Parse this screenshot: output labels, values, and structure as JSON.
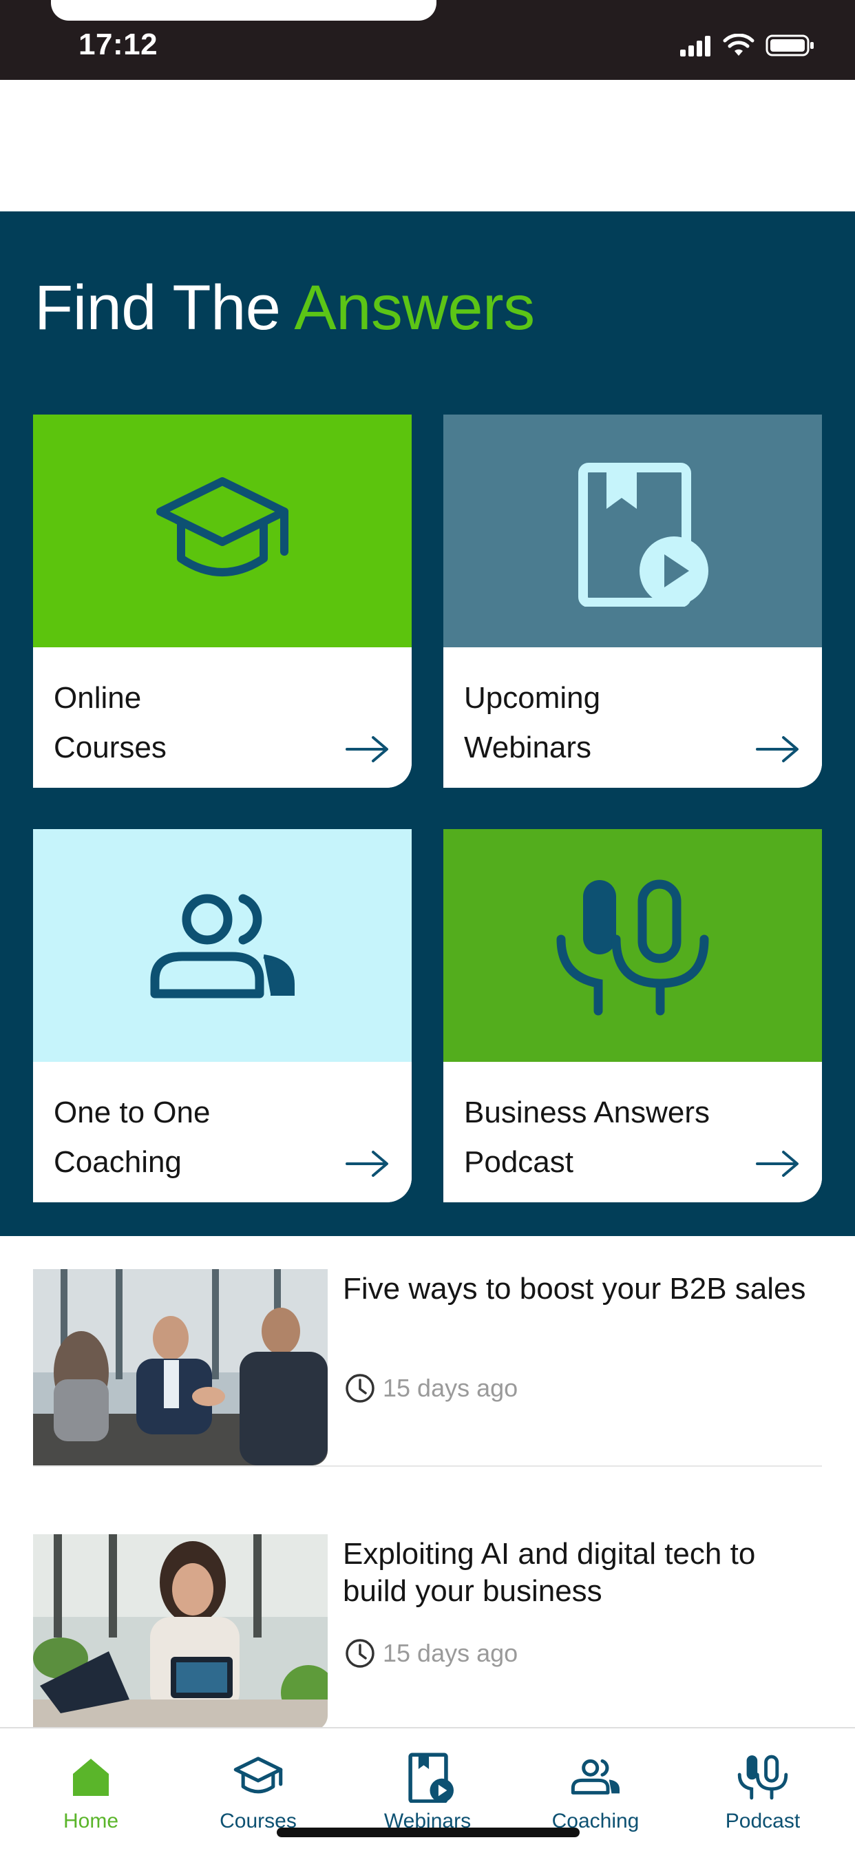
{
  "status_bar": {
    "time": "17:12"
  },
  "hero": {
    "title_part1": "Find The ",
    "title_accent": "Answers",
    "colors": {
      "background": "#023e58",
      "accent": "#5cc516"
    }
  },
  "cards": [
    {
      "label": "Online\nCourses",
      "icon": "graduation-cap-icon",
      "color": "#5cc40d"
    },
    {
      "label": "Upcoming\nWebinars",
      "icon": "book-play-icon",
      "color": "#4b7c90"
    },
    {
      "label": "One to One\nCoaching",
      "icon": "people-icon",
      "color": "#c6f4fb"
    },
    {
      "label": "Business Answers\nPodcast",
      "icon": "microphone-icon",
      "color": "#53ad1d"
    }
  ],
  "articles": [
    {
      "title": "Five ways to boost your B2B sales",
      "meta": "15 days ago",
      "image": "business-handshake-photo"
    },
    {
      "title": "Exploiting AI and digital tech to build your business",
      "meta": "15 days ago",
      "image": "woman-laptop-tablet-photo"
    }
  ],
  "tab_bar": {
    "tabs": [
      {
        "label": "Home",
        "icon": "home-icon",
        "active": true
      },
      {
        "label": "Courses",
        "icon": "graduation-cap-icon",
        "active": false
      },
      {
        "label": "Webinars",
        "icon": "book-play-icon",
        "active": false
      },
      {
        "label": "Coaching",
        "icon": "people-icon",
        "active": false
      },
      {
        "label": "Podcast",
        "icon": "microphone-icon",
        "active": false
      }
    ],
    "colors": {
      "active": "#5ab52a",
      "inactive": "#0d5172"
    }
  }
}
